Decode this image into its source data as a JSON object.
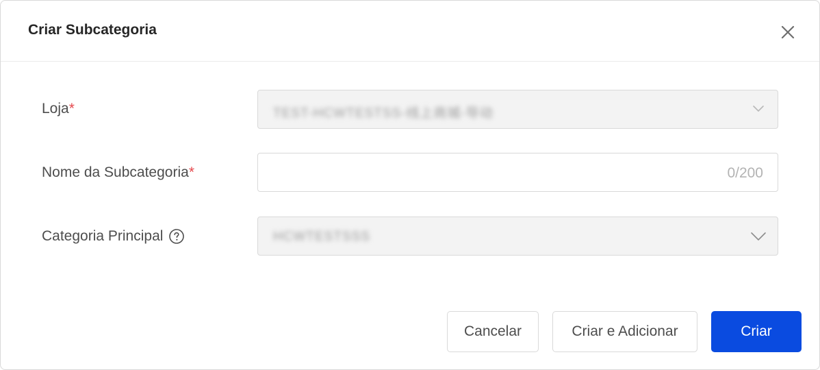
{
  "dialog": {
    "title": "Criar Subcategoria"
  },
  "form": {
    "store": {
      "label": "Loja",
      "required_mark": "*",
      "value": "TEST-HCWTESTSS-线上商城-导动",
      "icon": "chevron-down-icon",
      "disabled": true
    },
    "subcategory_name": {
      "label": "Nome da Subcategoria",
      "required_mark": "*",
      "value": "",
      "counter": "0/200"
    },
    "parent_category": {
      "label": "Categoria Principal",
      "help_icon": "question-circle-icon",
      "value": "HCWTESTSSS",
      "icon": "chevron-down-icon",
      "disabled": true
    }
  },
  "footer": {
    "cancel_label": "Cancelar",
    "create_and_add_label": "Criar e Adicionar",
    "create_label": "Criar"
  },
  "colors": {
    "primary": "#0a4be0",
    "required": "#e5484d",
    "disabled_bg": "#f3f3f3",
    "border": "#d9d9d9"
  }
}
